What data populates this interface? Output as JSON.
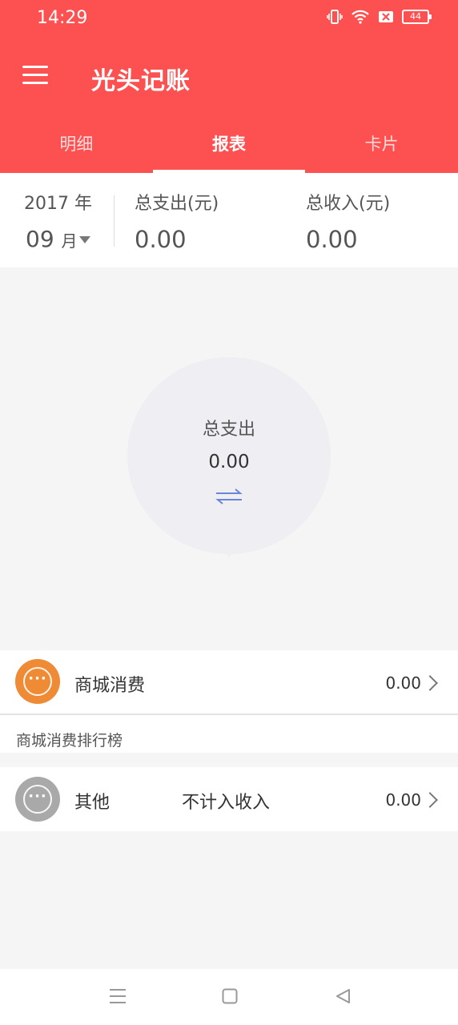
{
  "status_bar": {
    "time": "14:29",
    "battery": "44"
  },
  "header": {
    "app_title": "光头记账",
    "tabs": [
      {
        "label": "明细",
        "active": false
      },
      {
        "label": "报表",
        "active": true
      },
      {
        "label": "卡片",
        "active": false
      }
    ]
  },
  "summary": {
    "year": "2017 年",
    "month": "09",
    "month_unit": "月",
    "expense_label": "总支出(元)",
    "expense_value": "0.00",
    "income_label": "总收入(元)",
    "income_value": "0.00"
  },
  "chart": {
    "center_label": "总支出",
    "center_value": "0.00",
    "ring_color": "#eeeef3"
  },
  "rows": [
    {
      "name": "商城消费",
      "amount": "0.00",
      "icon": "more-icon",
      "icon_color": "#ef8a35"
    }
  ],
  "ranking": {
    "title": "商城消费排行榜",
    "items": [
      {
        "name": "其他",
        "note": "不计入收入",
        "amount": "0.00",
        "icon": "more-icon",
        "icon_color": "#a9a9a9"
      }
    ]
  },
  "colors": {
    "brand": "#fd5151",
    "background": "#f5f5f5"
  }
}
